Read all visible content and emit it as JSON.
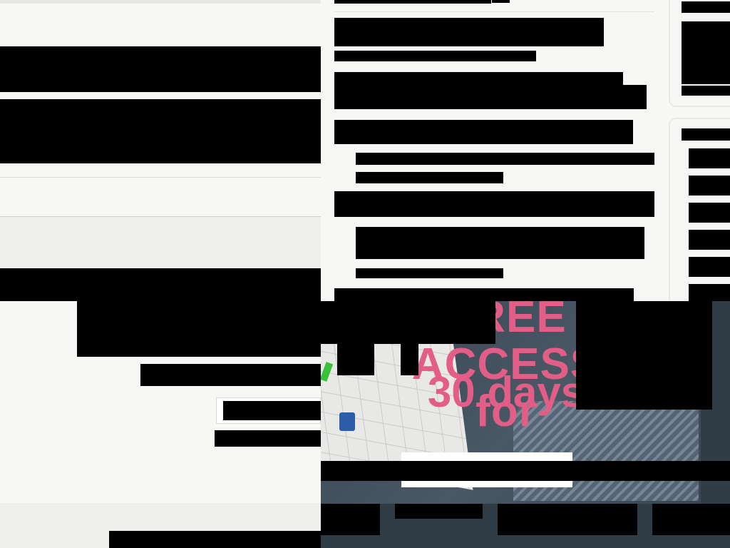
{
  "ad": {
    "headline_1": "FREE",
    "headline_2": "ACCESS for",
    "headline_3": "30 days"
  },
  "colors": {
    "ad_accent": "#e25e86",
    "ad_background": "#2f3b45",
    "page_background": "#f7f7f5"
  },
  "icons": {
    "device": "robot-device-icon"
  }
}
